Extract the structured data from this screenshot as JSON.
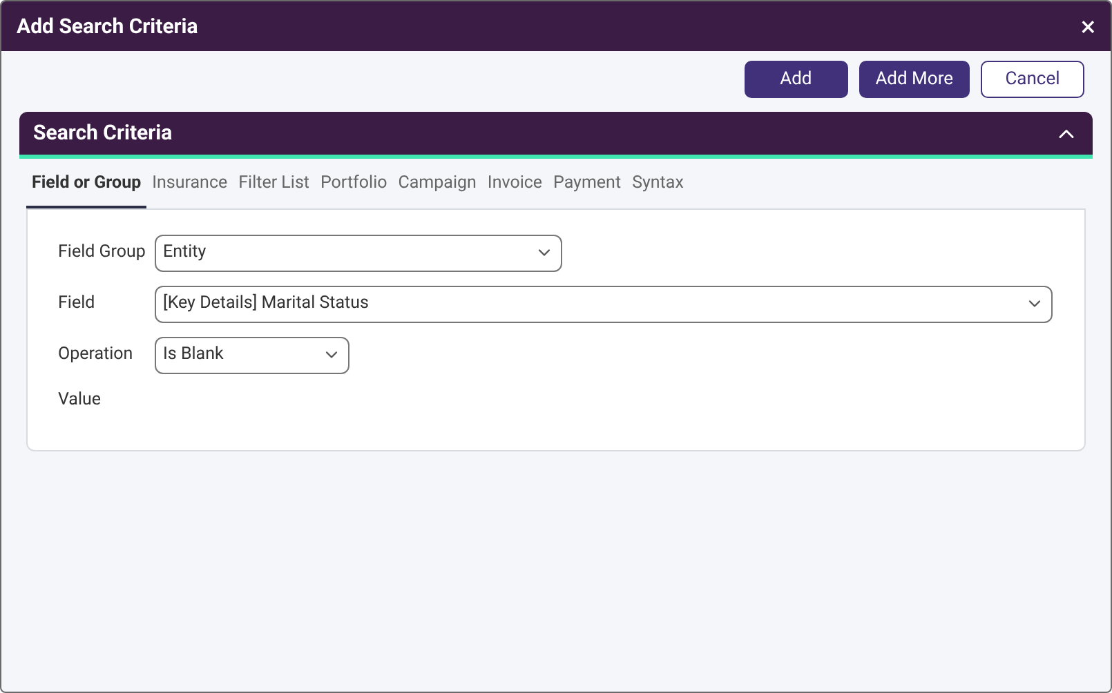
{
  "window": {
    "title": "Add Search Criteria",
    "close": "×"
  },
  "buttons": [
    {
      "label": "Add",
      "kind": "primary"
    },
    {
      "label": "Add More",
      "kind": "primary"
    },
    {
      "label": "Cancel",
      "kind": "outline"
    }
  ],
  "section": {
    "title": "Search Criteria",
    "expanded": true
  },
  "tabs": [
    {
      "label": "Field or Group",
      "selected": true
    },
    {
      "label": "Insurance",
      "selected": false
    },
    {
      "label": "Filter List",
      "selected": false
    },
    {
      "label": "Portfolio",
      "selected": false
    },
    {
      "label": "Campaign",
      "selected": false
    },
    {
      "label": "Invoice",
      "selected": false
    },
    {
      "label": "Payment",
      "selected": false
    },
    {
      "label": "Syntax",
      "selected": false
    }
  ],
  "form": [
    {
      "label": "Field Group",
      "kind": "select",
      "value": "Entity"
    },
    {
      "label": "Field",
      "kind": "select",
      "value": "[Key Details] Marital Status"
    },
    {
      "label": "Operation",
      "kind": "select",
      "value": "Is Blank"
    },
    {
      "label": "Value",
      "kind": "empty"
    }
  ]
}
